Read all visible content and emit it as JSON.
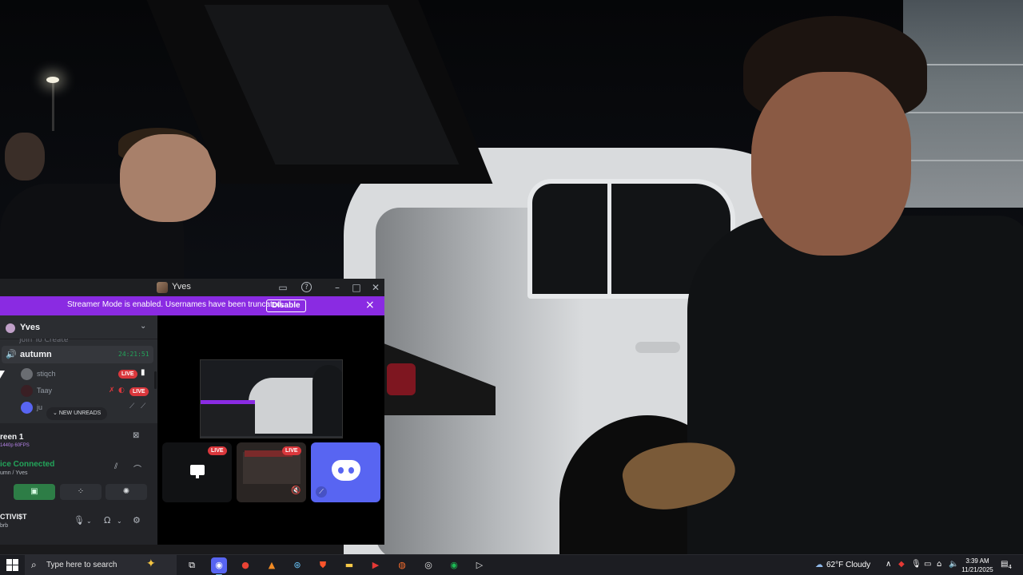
{
  "window": {
    "title": "Yves",
    "controls": {
      "inbox": "▭",
      "help": "?",
      "minimize": "–",
      "maximize": "□",
      "close": "✕"
    }
  },
  "banner": {
    "message": "Streamer Mode is enabled. Usernames have been truncated.",
    "disable_label": "Disable",
    "color": "#8a2be2"
  },
  "sidebar": {
    "server_name": "Yves",
    "cut_channel": "Join To Create",
    "voice_channel": {
      "name": "autumn",
      "timer": "24:21:51"
    },
    "members": [
      {
        "name": "stiqch",
        "live": "LIVE"
      },
      {
        "name": "Taay",
        "live": "LIVE"
      },
      {
        "name": "ju"
      }
    ],
    "new_unreads": "NEW UNREADS"
  },
  "stream_panel": {
    "title": "reen 1",
    "subtitle": "1440p 60FPS",
    "voice_status": "ice Connected",
    "voice_path": "umn / Yves"
  },
  "user_bar": {
    "name": "CTIVI$T",
    "status": "brb"
  },
  "main": {
    "tiles": [
      {
        "live": "LIVE",
        "icon": "screen-icon"
      },
      {
        "live": "LIVE",
        "icon": "muted-icon"
      },
      {
        "icon": "discord-logo"
      }
    ]
  },
  "taskbar": {
    "search_placeholder": "Type here to search",
    "weather": "62°F  Cloudy",
    "time": "3:39 AM",
    "date": "11/21/2025",
    "notifications": "4",
    "apps": [
      "task-view",
      "discord",
      "chrome",
      "vlc",
      "steam",
      "brave",
      "file-explorer",
      "media",
      "origin",
      "obs",
      "spotify",
      "player"
    ]
  },
  "colors": {
    "discord_bg": "#1e1f22",
    "sidebar_bg": "#2b2d31",
    "live_red": "#da373c",
    "connected_green": "#23a55a",
    "blurple": "#5865f2"
  }
}
